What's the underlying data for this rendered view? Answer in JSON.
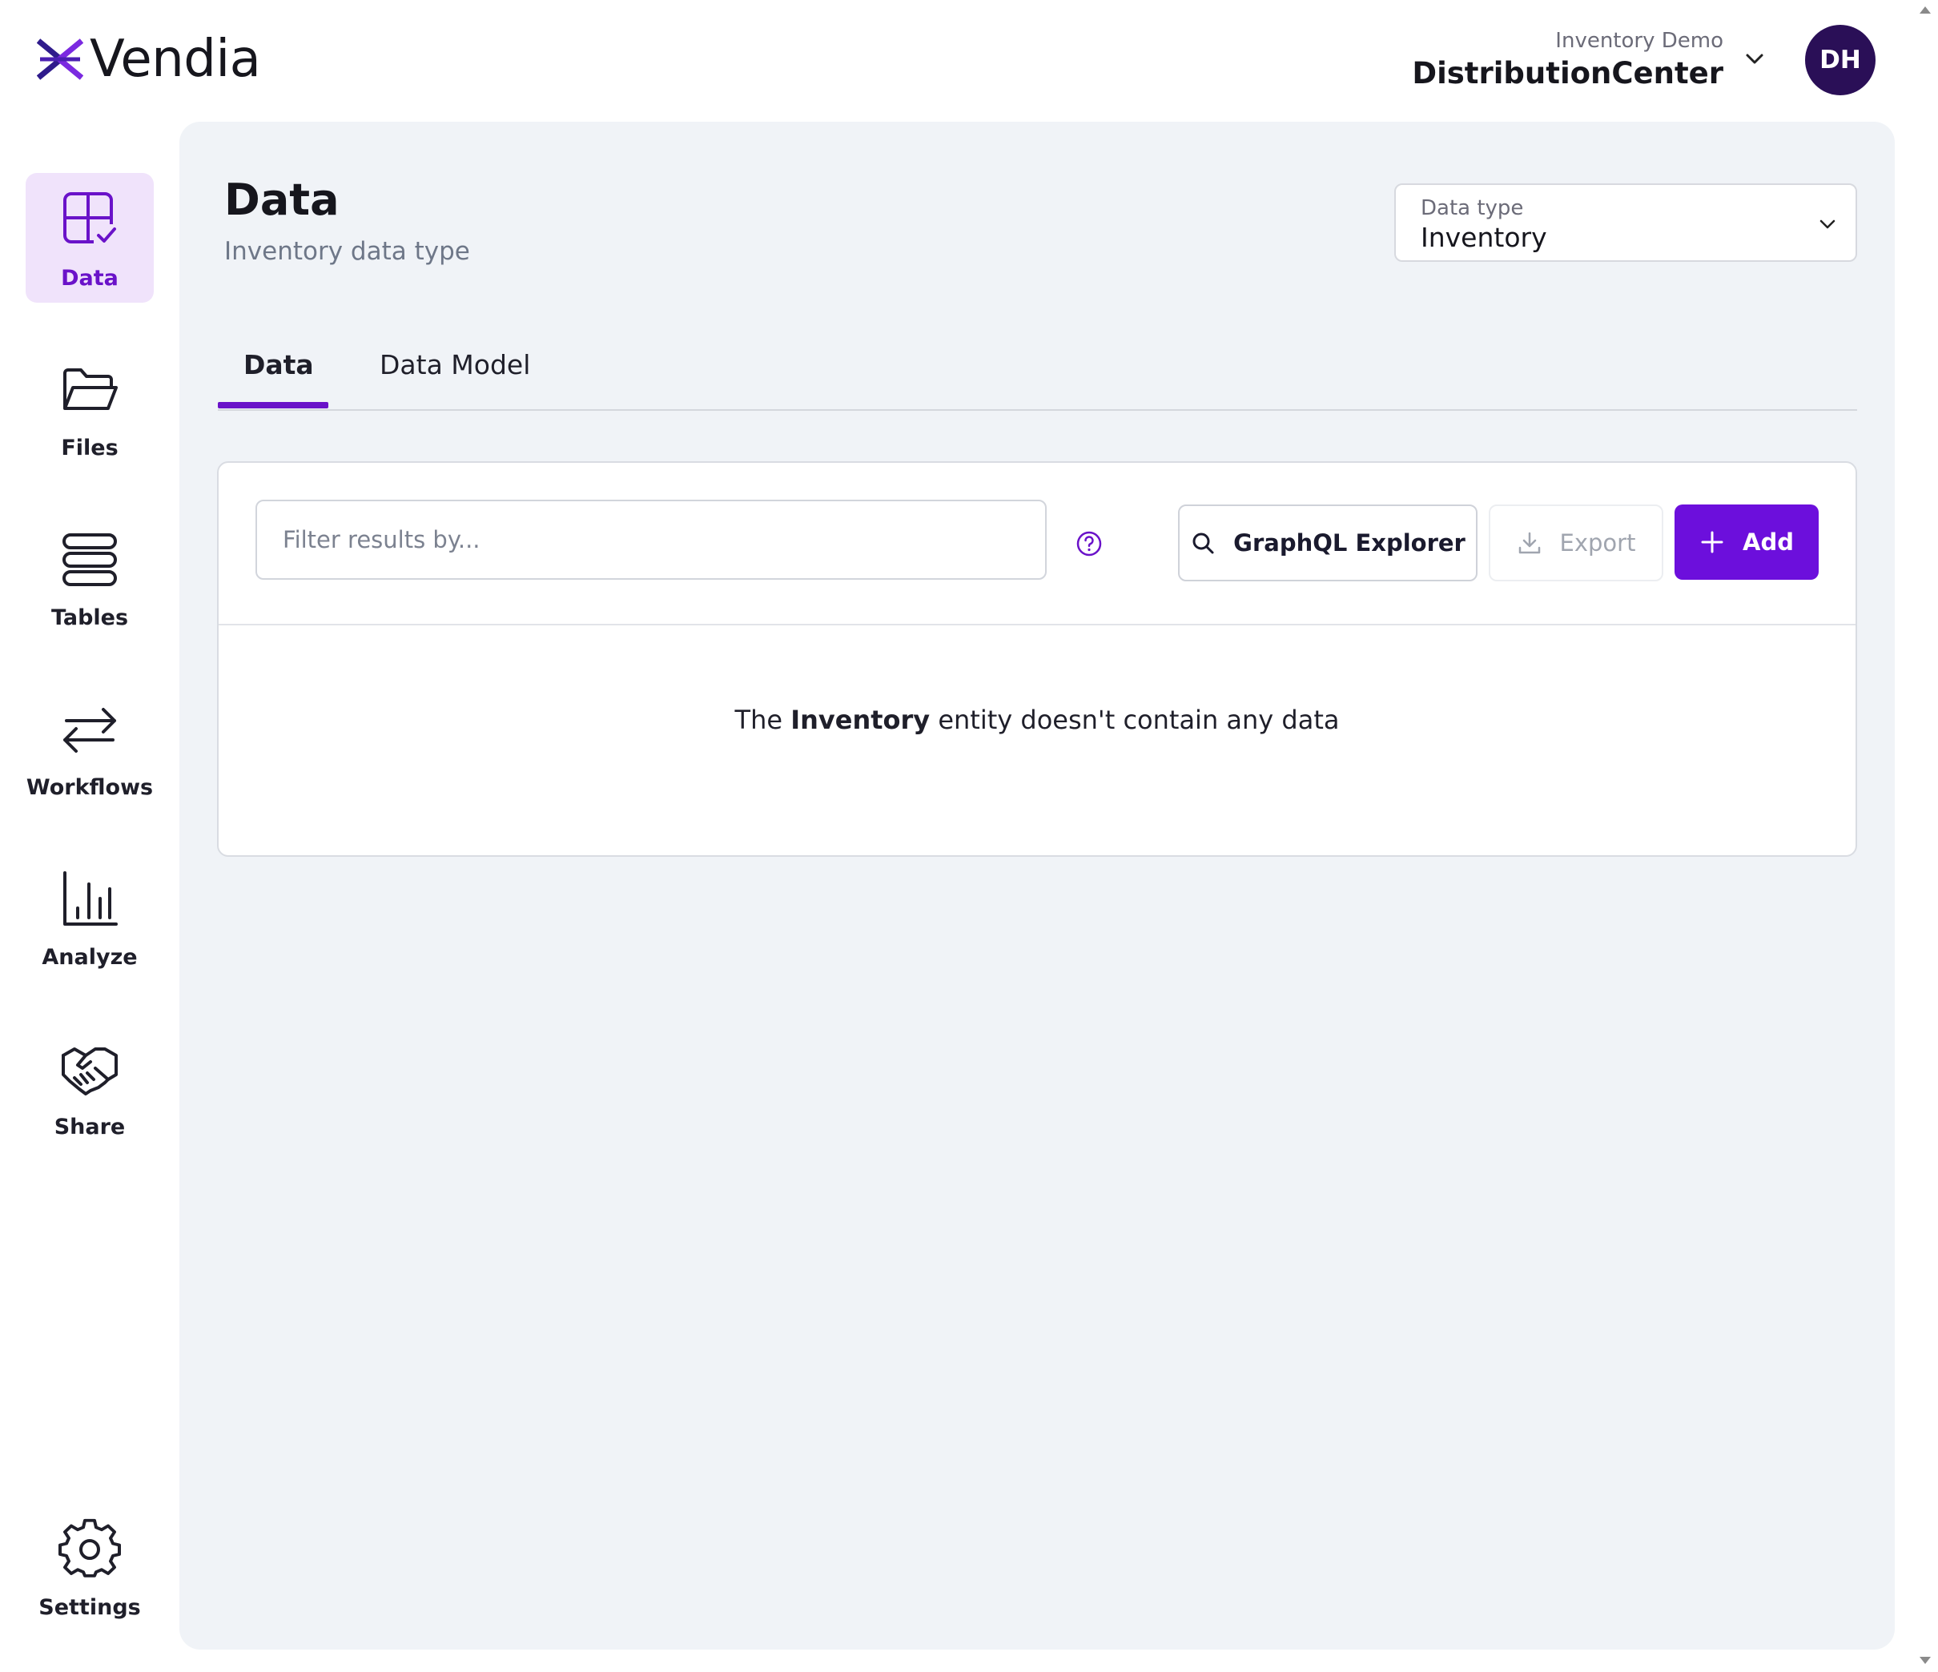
{
  "header": {
    "logo_text": "Vendia",
    "org_subtitle": "Inventory Demo",
    "org_name": "DistributionCenter",
    "avatar_initials": "DH"
  },
  "sidebar": {
    "items": [
      {
        "label": "Data",
        "icon": "data-grid-check-icon",
        "active": true
      },
      {
        "label": "Files",
        "icon": "folder-icon"
      },
      {
        "label": "Tables",
        "icon": "tables-stack-icon"
      },
      {
        "label": "Workflows",
        "icon": "arrows-exchange-icon"
      },
      {
        "label": "Analyze",
        "icon": "bar-chart-icon"
      },
      {
        "label": "Share",
        "icon": "handshake-icon"
      }
    ],
    "settings_label": "Settings"
  },
  "main": {
    "title": "Data",
    "subtitle": "Inventory data type",
    "data_type": {
      "label": "Data type",
      "value": "Inventory"
    },
    "tabs": [
      {
        "label": "Data",
        "active": true
      },
      {
        "label": "Data Model"
      }
    ],
    "toolbar": {
      "filter_placeholder": "Filter results by...",
      "graphql_label": "GraphQL Explorer",
      "export_label": "Export",
      "add_label": "Add"
    },
    "empty": {
      "prefix": "The",
      "entity": "Inventory",
      "suffix": "entity doesn't contain any data"
    }
  },
  "colors": {
    "accent": "#6c0fdc",
    "active_nav_bg": "#f0e3fb",
    "panel_bg": "#f0f3f7",
    "avatar_bg": "#2a0f57"
  }
}
